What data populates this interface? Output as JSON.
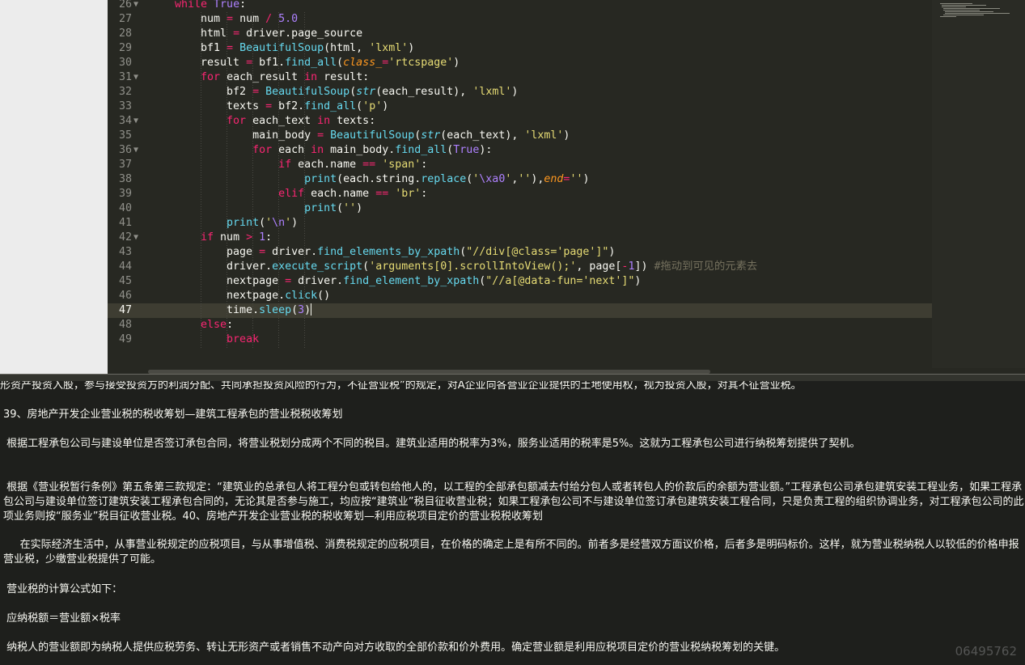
{
  "editor": {
    "lines": [
      {
        "n": "26",
        "fold": "▼",
        "html": "<span class=\"kw\">while</span> <span class=\"cn\">True</span>:"
      },
      {
        "n": "27",
        "fold": "",
        "html": "    num <span class=\"kw\">=</span> num <span class=\"kw\">/</span> <span class=\"cn\">5.0</span>"
      },
      {
        "n": "28",
        "fold": "",
        "html": "    html <span class=\"kw\">=</span> driver.page_source"
      },
      {
        "n": "29",
        "fold": "",
        "html": "    bf1 <span class=\"kw\">=</span> <span class=\"fn\">BeautifulSoup</span>(html, <span class=\"st\">'lxml'</span>)"
      },
      {
        "n": "30",
        "fold": "",
        "html": "    result <span class=\"kw\">=</span> bf1.<span class=\"fn\">find_all</span>(<span class=\"it\">class_</span><span class=\"kw\">=</span><span class=\"st\">'rtcspage'</span>)"
      },
      {
        "n": "31",
        "fold": "▼",
        "html": "    <span class=\"kw\">for</span> each_result <span class=\"kw\">in</span> result:"
      },
      {
        "n": "32",
        "fold": "",
        "html": "        bf2 <span class=\"kw\">=</span> <span class=\"fn\">BeautifulSoup</span>(<span class=\"bi\">str</span>(each_result), <span class=\"st\">'lxml'</span>)"
      },
      {
        "n": "33",
        "fold": "",
        "html": "        texts <span class=\"kw\">=</span> bf2.<span class=\"fn\">find_all</span>(<span class=\"st\">'p'</span>)"
      },
      {
        "n": "34",
        "fold": "▼",
        "html": "        <span class=\"kw\">for</span> each_text <span class=\"kw\">in</span> texts:"
      },
      {
        "n": "35",
        "fold": "",
        "html": "            main_body <span class=\"kw\">=</span> <span class=\"fn\">BeautifulSoup</span>(<span class=\"bi\">str</span>(each_text), <span class=\"st\">'lxml'</span>)"
      },
      {
        "n": "36",
        "fold": "▼",
        "html": "            <span class=\"kw\">for</span> each <span class=\"kw\">in</span> main_body.<span class=\"fn\">find_all</span>(<span class=\"cn\">True</span>):"
      },
      {
        "n": "37",
        "fold": "",
        "html": "                <span class=\"kw\">if</span> each.name <span class=\"kw\">==</span> <span class=\"st\">'span'</span>:"
      },
      {
        "n": "38",
        "fold": "",
        "html": "                    <span class=\"fn\">print</span>(each.string.<span class=\"fn\">replace</span>(<span class=\"st\">'</span><span class=\"cn\">\\xa0</span><span class=\"st\">'</span>,<span class=\"st\">''</span>),<span class=\"it\">end</span><span class=\"kw\">=</span><span class=\"st\">''</span>)"
      },
      {
        "n": "39",
        "fold": "",
        "html": "                <span class=\"kw\">elif</span> each.name <span class=\"kw\">==</span> <span class=\"st\">'br'</span>:"
      },
      {
        "n": "40",
        "fold": "",
        "html": "                    <span class=\"fn\">print</span>(<span class=\"st\">''</span>)"
      },
      {
        "n": "41",
        "fold": "",
        "html": "        <span class=\"fn\">print</span>(<span class=\"st\">'</span><span class=\"cn\">\\n</span><span class=\"st\">'</span>)"
      },
      {
        "n": "42",
        "fold": "▼",
        "html": "    <span class=\"kw\">if</span> num <span class=\"kw\">&gt;</span> <span class=\"cn\">1</span>:"
      },
      {
        "n": "43",
        "fold": "",
        "html": "        page <span class=\"kw\">=</span> driver.<span class=\"fn\">find_elements_by_xpath</span>(<span class=\"st\">\"//div[@class='page']\"</span>)"
      },
      {
        "n": "44",
        "fold": "",
        "html": "        driver.<span class=\"fn\">execute_script</span>(<span class=\"st\">'arguments[0].scrollIntoView();'</span>, page[<span class=\"kw\">-</span><span class=\"cn\">1</span>]) <span class=\"cm\">#拖动到可见的元素去</span>"
      },
      {
        "n": "45",
        "fold": "",
        "html": "        nextpage <span class=\"kw\">=</span> driver.<span class=\"fn\">find_element_by_xpath</span>(<span class=\"st\">\"//a[@data-fun='next']\"</span>)"
      },
      {
        "n": "46",
        "fold": "",
        "html": "        nextpage.<span class=\"fn\">click</span>()"
      },
      {
        "n": "47",
        "fold": "",
        "html": "        time.<span class=\"fn\">sleep</span>(<span class=\"cn\">3</span>)<span class=\"cursor\"></span>"
      },
      {
        "n": "48",
        "fold": "",
        "html": "    <span class=\"kw\">else</span>:"
      },
      {
        "n": "49",
        "fold": "",
        "html": "        <span class=\"kw\">break</span>"
      }
    ]
  },
  "output": {
    "line1": "形资产投资入股，参与接受投资方的利润分配、共同承担投资风险的行为，不征营业税”的规定，对A企业向各营业企业提供的土地使用权，视为投资入股，对其不征营业税。",
    "line2": "39、房地产开发企业营业税的税收筹划—建筑工程承包的营业税税收筹划",
    "para3": " 根据工程承包公司与建设单位是否签订承包合同，将营业税划分成两个不同的税目。建筑业适用的税率为3%，服务业适用的税率是5%。这就为工程承包公司进行纳税筹划提供了契机。",
    "para4": " 根据《营业税暂行条例》第五条第三款规定：“建筑业的总承包人将工程分包或转包给他人的，以工程的全部承包额减去付给分包人或者转包人的价款后的余额为营业额。”工程承包公司承包建筑安装工程业务，如果工程承包公司与建设单位签订建筑安装工程承包合同的，无论其是否参与施工，均应按“建筑业”税目征收营业税；如果工程承包公司不与建设单位签订承包建筑安装工程合同，只是负责工程的组织协调业务，对工程承包公司的此项业务则按“服务业”税目征收营业税。40、房地产开发企业营业税的税收筹划—利用应税项目定价的营业税税收筹划",
    "para5": "     在实际经济生活中，从事营业税规定的应税项目，与从事增值税、消费税规定的应税项目，在价格的确定上是有所不同的。前者多是经营双方面议价格，后者多是明码标价。这样，就为营业税纳税人以较低的价格申报营业税，少缴营业税提供了可能。",
    "line6": " 营业税的计算公式如下：",
    "line7": " 应纳税额＝营业额×税率",
    "line8": " 纳税人的营业额即为纳税人提供应税劳务、转让无形资产或者销售不动产向对方收取的全部价款和价外费用。确定营业额是利用应税项目定价的营业税纳税筹划的关键。",
    "watermark": "06495762"
  }
}
